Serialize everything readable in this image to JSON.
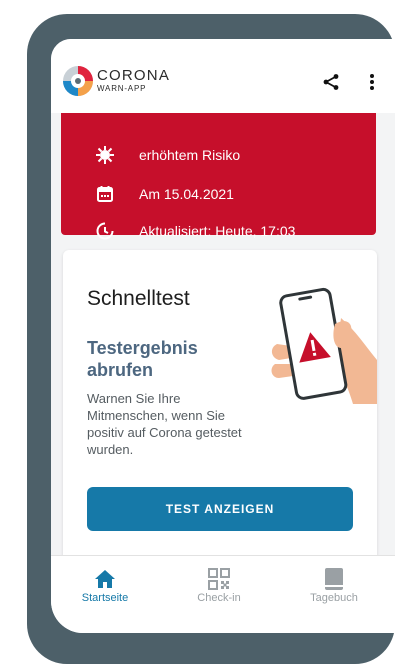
{
  "app": {
    "brand_title": "CORONA",
    "brand_subtitle": "WARN-APP"
  },
  "header": {
    "icons": [
      "share-icon",
      "more-vert-icon"
    ]
  },
  "risk_card": {
    "color": "#c60f2b",
    "rows": [
      {
        "icon": "virus-icon",
        "text": "erhöhtem Risiko"
      },
      {
        "icon": "calendar-icon",
        "text": "Am 15.04.2021"
      },
      {
        "icon": "clock-icon",
        "text": "Aktualisiert: Heute, 17:03"
      }
    ]
  },
  "test_card": {
    "title": "Schnelltest",
    "subtitle": "Testergebnis abrufen",
    "body": "Warnen Sie Ihre Mitmenschen, wenn Sie positiv auf Corona getestet wurden.",
    "button_label": "TEST ANZEIGEN",
    "button_color": "#1679a8"
  },
  "bottom_nav": {
    "items": [
      {
        "label": "Startseite",
        "icon": "home-icon",
        "active": true
      },
      {
        "label": "Check-in",
        "icon": "qr-code-icon",
        "active": false
      },
      {
        "label": "Tagebuch",
        "icon": "book-icon",
        "active": false
      }
    ]
  }
}
